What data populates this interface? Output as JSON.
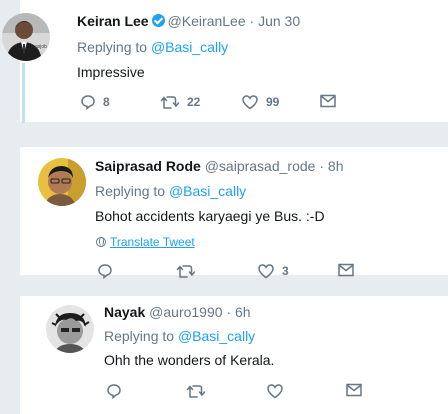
{
  "tweets": [
    {
      "name": "Keiran Lee",
      "handle": "@KeiranLee",
      "time": "Jun 30",
      "verified": true,
      "replying_prefix": "Replying to",
      "replying_to": "@Basi_cally",
      "text": "Impressive",
      "replies": "8",
      "retweets": "22",
      "likes": "99"
    },
    {
      "name": "Saiprasad Rode",
      "handle": "@saiprasad_rode",
      "time": "8h",
      "replying_prefix": "Replying to",
      "replying_to": "@Basi_cally",
      "text": "Bohot accidents karyaegi ye Bus. :-D",
      "translate": "Translate Tweet",
      "replies": "",
      "retweets": "",
      "likes": "3"
    },
    {
      "name": "Nayak",
      "handle": "@auro1990",
      "time": "6h",
      "replying_prefix": "Replying to",
      "replying_to": "@Basi_cally",
      "text": "Ohh the wonders of Kerala.",
      "replies": "",
      "retweets": "",
      "likes": ""
    }
  ],
  "separator": "·",
  "colors": {
    "link": "#1da1f2",
    "muted": "#657786",
    "thread_line": "#c4dff2"
  },
  "icons": [
    "reply-icon",
    "retweet-icon",
    "like-icon",
    "message-icon",
    "verified-badge-icon",
    "globe-icon"
  ]
}
